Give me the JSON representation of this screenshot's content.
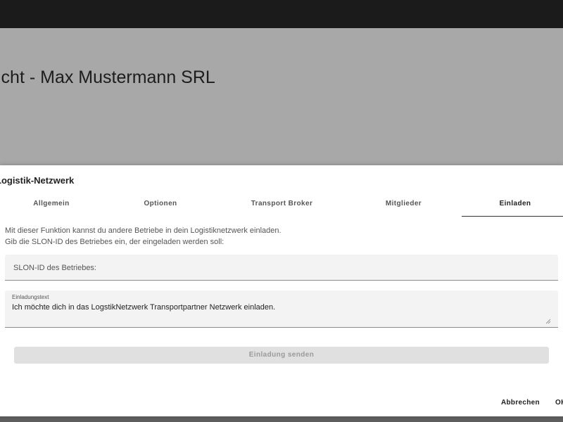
{
  "page": {
    "title": "icht - Max Mustermann SRL"
  },
  "dialog": {
    "title": "Logistik-Netzwerk",
    "tabs": [
      {
        "label": "Allgemein",
        "active": false
      },
      {
        "label": "Optionen",
        "active": false
      },
      {
        "label": "Transport Broker",
        "active": false
      },
      {
        "label": "Mitglieder",
        "active": false
      },
      {
        "label": "Einladen",
        "active": true
      }
    ],
    "intro_line1": "Mit dieser Funktion kannst du andere Betriebe in dein Logistiknetzwerk einladen.",
    "intro_line2": "Gib die SLON-ID des Betriebes ein, der eingeladen werden soll:",
    "slon_field": {
      "placeholder": "SLON-ID des Betriebes:",
      "value": ""
    },
    "invitation_field": {
      "label": "Einladungstext",
      "value": "Ich möchte dich in das LogstikNetzwerk Transportpartner Netzwerk einladen."
    },
    "send_button_label": "Einladung senden",
    "cancel_label": "Abbrechen",
    "ok_label": "OK"
  },
  "colors": {
    "topbar": "#1b1b1b",
    "backdrop": "#a8a8a8",
    "dialog_bg": "#ffffff",
    "field_bg": "#f3f3f3",
    "disabled_button_bg": "#e0e0e0",
    "disabled_button_text": "#9a9a9a"
  }
}
